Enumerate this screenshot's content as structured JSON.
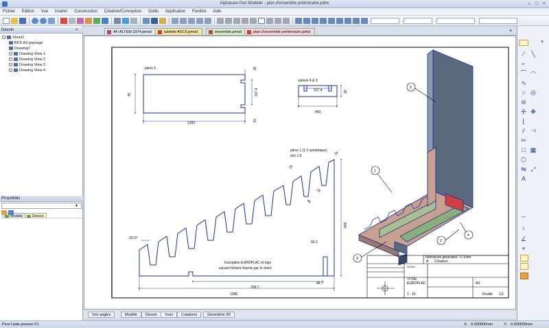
{
  "window": {
    "title": "Alphacam Part Modeler - plan d'ensemble préliminaire.pdrw"
  },
  "menu": [
    "Fichier",
    "Edition",
    "Vue",
    "Insérer",
    "Construction",
    "Création/Conception",
    "Outils",
    "Application",
    "Fenêtre",
    "Aide"
  ],
  "left_panel": {
    "header": "Dessin",
    "tree": [
      {
        "label": "Sheet1",
        "level": 0,
        "expand": "-"
      },
      {
        "label": "BDS A3 paysage",
        "level": 1,
        "expand": ""
      },
      {
        "label": "Drawing7",
        "level": 1,
        "expand": ""
      },
      {
        "label": "Drawing View 1",
        "level": 1,
        "expand": "+"
      },
      {
        "label": "Drawing View 2",
        "level": 1,
        "expand": "+"
      },
      {
        "label": "Drawing View 3",
        "level": 1,
        "expand": "+"
      },
      {
        "label": "Drawing View 4",
        "level": 1,
        "expand": "+"
      }
    ],
    "tabs": [
      "Modèle",
      "Dessin"
    ],
    "properties_header": "Propriétés"
  },
  "doc_tabs": [
    "AF-ALTEM 3374.pmod",
    "tablette ASCII.pmod",
    "ensemble.pmod",
    "plan d'ensemble préliminaire.pdrw"
  ],
  "bottom_tabs": [
    "Voir angles",
    "Modèle",
    "Dessin",
    "Vues",
    "Cotations",
    "Géométrie 2D"
  ],
  "status": {
    "left": "Pour l'aide presser F1",
    "coord_x_label": "X:",
    "coord_x": "0.000000mm",
    "coord_y_label": "Y:",
    "coord_y": "0.000000mm"
  },
  "drawing": {
    "view1": {
      "label": "pièce 5",
      "dim_height": "45",
      "dim_width": "1200",
      "dim_notch": "30",
      "dim_inner": "317.4",
      "dim_small": "10"
    },
    "view2": {
      "label": "pièces 4 & 3",
      "dim_top": "317.4",
      "dim_width": "443",
      "dim_height": "18"
    },
    "view3": {
      "label": "pièce 1 (1 2 symétrique)",
      "label2": "éch 1:5",
      "dim_angle": "20.07",
      "dim_base": "1286",
      "dim_length": "709.7",
      "dim_height": "649",
      "dim_small": "48.7",
      "dim_notch": "56.3",
      "dim_r1": "18",
      "dim_r2": "26",
      "dim_r3": "28",
      "dim_r4": "46",
      "note1": "Inscription EUROPLAC et logo",
      "note2": "suivant fichiers fournis par le client"
    },
    "balloons": [
      "5",
      "1",
      "2",
      "4",
      "3"
    ],
    "tolerance": "Tolérances générales: +/-1mm",
    "titleblock": {
      "scale_label": "A",
      "creator_label": "Créateur",
      "title": "TITRE",
      "ref": "EUROPLAC",
      "format": "A3",
      "scale": "1 : 10",
      "sheet": "1/1",
      "company": "SOLID",
      "sheet_label": "Feuille"
    }
  },
  "colors": {
    "accent": "#3a72c8",
    "dim_line": "#1a2f9a",
    "panel_head": "#c7d4e6"
  },
  "icons": {
    "toolbar": [
      "new-icon",
      "open-icon",
      "save-icon",
      "undo-icon",
      "redo-icon",
      "print-icon",
      "zoom-icon",
      "view-icon",
      "shade-icon"
    ],
    "right": [
      "select-icon",
      "line-icon",
      "arc-icon",
      "circle-icon",
      "spline-icon",
      "rectangle-icon",
      "polygon-icon",
      "dimension-icon",
      "snap-icon"
    ]
  }
}
